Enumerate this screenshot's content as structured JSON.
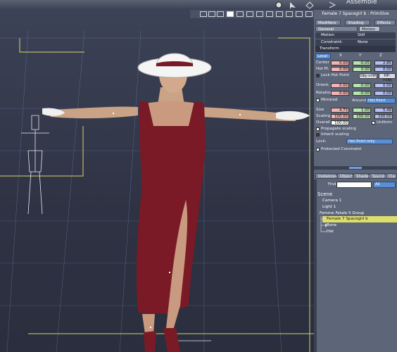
{
  "window": {
    "title": "Assemble"
  },
  "viewport": {
    "toolbar_icons": [
      "grid-icon",
      "sphere-icon",
      "cube-icon",
      "light-icon",
      "camera-icon",
      "render-icon"
    ]
  },
  "panel": {
    "title": "Female 7 Spacegirl b : Primitive",
    "tabs_top": [
      {
        "label": "Modifiers"
      },
      {
        "label": "Shading"
      },
      {
        "label": "Effects"
      }
    ],
    "tabs_second": [
      {
        "label": "General"
      },
      {
        "label": "Motion"
      }
    ],
    "motion": {
      "label": "Motion",
      "value": "Still"
    },
    "constraint": {
      "label": "Constraint:",
      "value": "None"
    },
    "transform_header": "Transform",
    "local_select": "Local",
    "axes": [
      "X",
      "Y",
      "Z"
    ],
    "center": {
      "label": "Center",
      "x": "0.00",
      "y": "-0.05",
      "z": "2.85"
    },
    "hot_pt": {
      "label": "Hot Pt.",
      "x": "0.00",
      "y": "0.00",
      "z": "0.00"
    },
    "lock_hot_point": "Lock Hot Point",
    "obj_hp_button": "Obj->HP",
    "hp_obj_button": "HP->Obj",
    "orient": {
      "label": "Orient.",
      "x": "0.00",
      "y": "-0.00",
      "z": "0.00"
    },
    "rotation": {
      "label": "Rotation",
      "x": "0.00",
      "y": "-0.00",
      "z": "0.00"
    },
    "mirrored": "Mirrored",
    "around_label": "Around",
    "around_value": "Hot Point",
    "size": {
      "label": "Size",
      "x": "4.73",
      "y": "1.00",
      "z": "5.49"
    },
    "scaling": {
      "label": "Scaling",
      "x": "100.00",
      "y": "100.00",
      "z": "100.00"
    },
    "overall": {
      "label": "Overall",
      "value": "100.00"
    },
    "uniform": "Uniform",
    "propagate_scaling": "Propagate scaling",
    "inherit_scaling": "Inherit scaling",
    "lock_label": "Lock:",
    "lock_value": "Hot Point only",
    "protected_constraint": "Protected Constraint",
    "bottom_tabs": [
      {
        "label": "Instances"
      },
      {
        "label": "Objects"
      },
      {
        "label": "Shaders"
      },
      {
        "label": "Sounds"
      },
      {
        "label": "Cla"
      }
    ],
    "find_label": "Find:",
    "find_value": "",
    "find_filter": "All",
    "scene": {
      "label": "Scene",
      "items": [
        {
          "label": "Camera 1"
        },
        {
          "label": "Light 1"
        },
        {
          "label": "Femme Fatale 5 Group"
        },
        {
          "label": "Female 7 Spacegirl b"
        },
        {
          "label": "Bone"
        },
        {
          "label": "Hat"
        }
      ]
    }
  },
  "colors": {
    "selection": "#dede6e",
    "accent_blue": "#5b8fd3",
    "dress": "#7a1a26"
  }
}
